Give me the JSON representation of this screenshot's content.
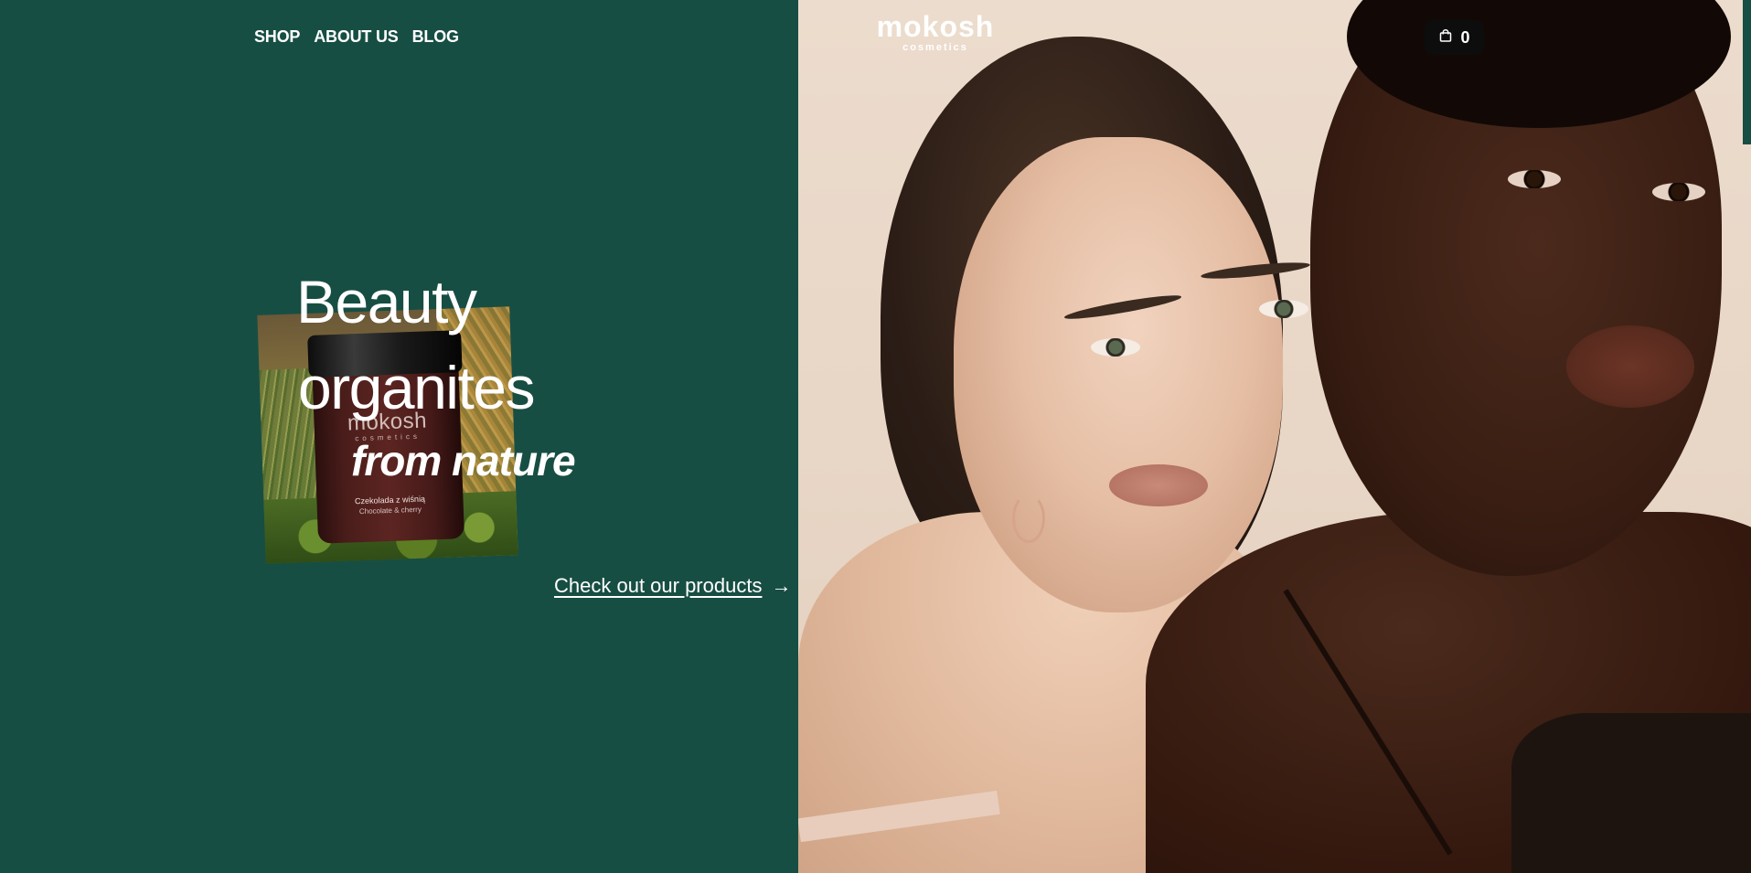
{
  "nav": {
    "items": [
      {
        "label": "SHOP"
      },
      {
        "label": "ABOUT US"
      },
      {
        "label": "BLOG"
      }
    ]
  },
  "logo": {
    "wordmark": "mokosh",
    "sub": "cosmetics"
  },
  "cart": {
    "count": "0",
    "icon": "shopping-bag-icon"
  },
  "hero": {
    "line1": "Beauty",
    "line2": "organites",
    "line3": "from nature",
    "cta": "Check out our products",
    "cta_arrow": "→"
  },
  "product": {
    "brand": "mokosh",
    "brand_sub": "cosmetics",
    "flavor": "Czekolada z wiśnią",
    "flavor_en": "Chocolate & cherry"
  },
  "colors": {
    "panel_green": "#174e43",
    "text": "#ffffff",
    "cart_bg": "#0d0d0d"
  }
}
